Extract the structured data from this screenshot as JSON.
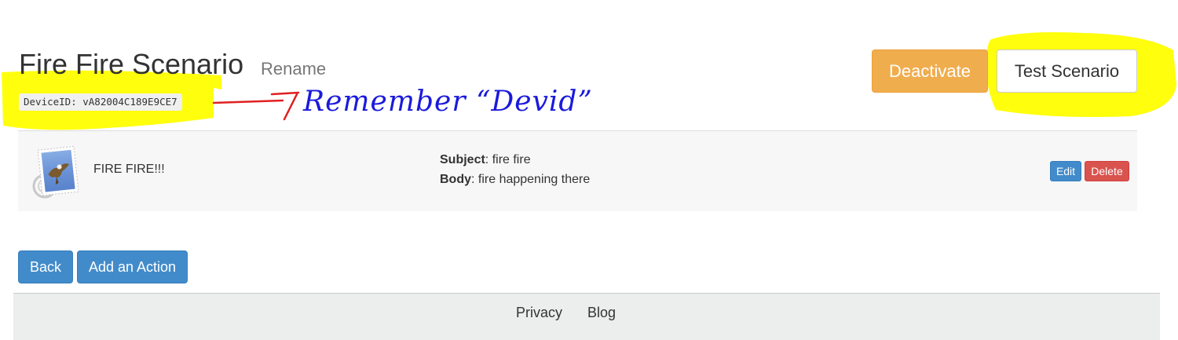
{
  "scenario": {
    "title": "Fire Fire Scenario",
    "rename_label": "Rename",
    "device_id": "DeviceID: vA82004C189E9CE7"
  },
  "header_buttons": {
    "deactivate_label": "Deactivate",
    "test_label": "Test Scenario"
  },
  "actions": [
    {
      "icon": "mail-stamp-icon",
      "name": "FIRE FIRE!!!",
      "subject_label": "Subject",
      "subject_value": ": fire fire",
      "body_label": "Body",
      "body_value": ": fire happening there",
      "edit_label": "Edit",
      "delete_label": "Delete"
    }
  ],
  "bottom_buttons": {
    "back_label": "Back",
    "add_action_label": "Add an Action"
  },
  "footer": {
    "links": [
      "Privacy",
      "Blog"
    ]
  },
  "annotation": {
    "handwritten_note": "Remember “Devid”",
    "highlight_color": "#ffff00",
    "arrow_color": "#e02020",
    "note_color": "#1a1adc"
  },
  "colors": {
    "warning": "#f0ad4e",
    "primary": "#428bca",
    "danger": "#d9534f"
  }
}
